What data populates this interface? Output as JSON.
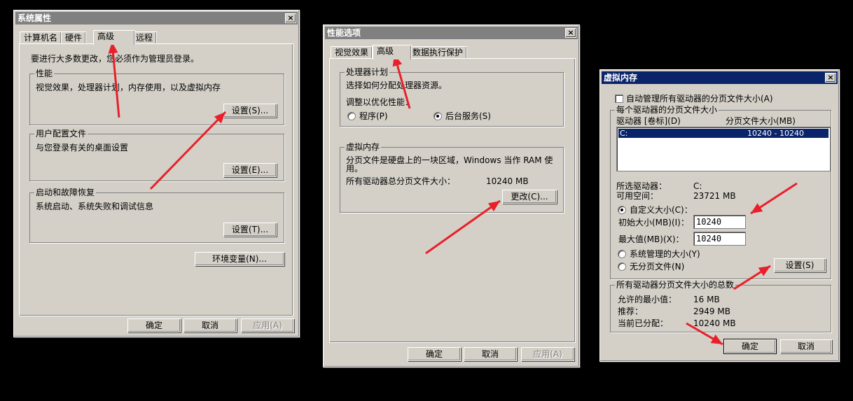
{
  "system_properties": {
    "title": "系统属性",
    "close_icon": "×",
    "tabs": [
      "计算机名",
      "硬件",
      "高级",
      "远程"
    ],
    "admin_notice": "要进行大多数更改，您必须作为管理员登录。",
    "performance": {
      "label": "性能",
      "desc": "视觉效果，处理器计划，内存使用，以及虚拟内存",
      "button": "设置(S)..."
    },
    "user_profiles": {
      "label": "用户配置文件",
      "desc": "与您登录有关的桌面设置",
      "button": "设置(E)..."
    },
    "startup_recovery": {
      "label": "启动和故障恢复",
      "desc": "系统启动、系统失败和调试信息",
      "button": "设置(T)..."
    },
    "env_button": "环境变量(N)...",
    "ok": "确定",
    "cancel": "取消",
    "apply": "应用(A)"
  },
  "performance_options": {
    "title": "性能选项",
    "close_icon": "×",
    "tabs": [
      "视觉效果",
      "高级",
      "数据执行保护"
    ],
    "processor": {
      "label": "处理器计划",
      "desc": "选择如何分配处理器资源。",
      "adjust": "调整以优化性能：",
      "opt_programs": "程序(P)",
      "opt_background": "后台服务(S)"
    },
    "virtual_memory": {
      "label": "虚拟内存",
      "desc_line1": "分页文件是硬盘上的一块区域，Windows 当作 RAM 使",
      "desc_line2": "用。",
      "total_label": "所有驱动器总分页文件大小：",
      "total_value": "10240 MB",
      "change_button": "更改(C)..."
    },
    "ok": "确定",
    "cancel": "取消",
    "apply": "应用(A)"
  },
  "virtual_memory": {
    "title": "虚拟内存",
    "close_icon": "×",
    "auto_manage": "自动管理所有驱动器的分页文件大小(A)",
    "per_drive_label": "每个驱动器的分页文件大小",
    "col_drive": "驱动器 [卷标](D)",
    "col_size": "分页文件大小(MB)",
    "rows": [
      {
        "drive": "C:",
        "size": "10240 - 10240"
      }
    ],
    "selected_drive_label": "所选驱动器：",
    "selected_drive_value": "C:",
    "free_space_label": "可用空间：",
    "free_space_value": "23721 MB",
    "custom_size": "自定义大小(C)：",
    "initial_label": "初始大小(MB)(I)：",
    "initial_value": "10240",
    "max_label": "最大值(MB)(X)：",
    "max_value": "10240",
    "system_managed": "系统管理的大小(Y)",
    "no_paging": "无分页文件(N)",
    "set_button": "设置(S)",
    "totals_label": "所有驱动器分页文件大小的总数",
    "min_allowed_label": "允许的最小值：",
    "min_allowed_value": "16 MB",
    "recommended_label": "推荐：",
    "recommended_value": "2949 MB",
    "current_label": "当前已分配：",
    "current_value": "10240 MB",
    "ok": "确定",
    "cancel": "取消"
  },
  "annotation_color": "#e8202a"
}
